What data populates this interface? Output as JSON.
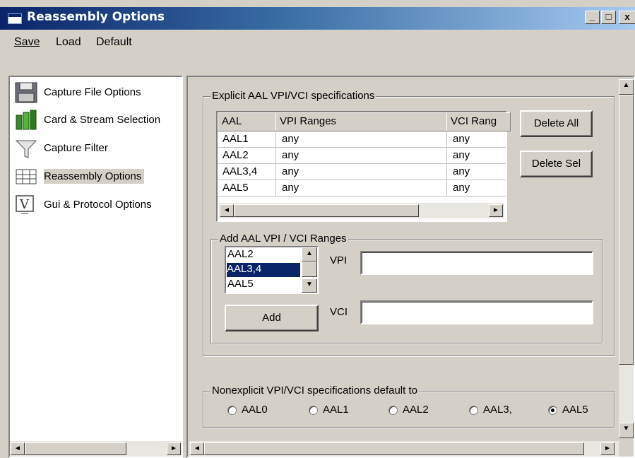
{
  "window": {
    "title": "Reassembly Options",
    "minimize": "_",
    "maximize": "□",
    "close": "x"
  },
  "menu": {
    "save": "Save",
    "load": "Load",
    "default": "Default"
  },
  "nav": [
    {
      "label": "Capture File Options",
      "icon": "floppy-disk-icon"
    },
    {
      "label": "Card & Stream Selection",
      "icon": "card-icon"
    },
    {
      "label": "Capture Filter",
      "icon": "funnel-icon"
    },
    {
      "label": "Reassembly Options",
      "icon": "reassembly-icon",
      "selected": true
    },
    {
      "label": "Gui & Protocol Options",
      "icon": "monitor-icon"
    }
  ],
  "explicit": {
    "title": "Explicit AAL VPI/VCI specifications",
    "columns": [
      "AAL",
      "VPI Ranges",
      "VCI Rang"
    ],
    "rows": [
      [
        "AAL1",
        "any",
        "any"
      ],
      [
        "AAL2",
        "any",
        "any"
      ],
      [
        "AAL3,4",
        "any",
        "any"
      ],
      [
        "AAL5",
        "any",
        "any"
      ]
    ],
    "delete_all": "Delete All",
    "delete_sel": "Delete Sel"
  },
  "add": {
    "title": "Add AAL VPI / VCI Ranges",
    "list": [
      "AAL2",
      "AAL3,4",
      "AAL5"
    ],
    "selected": "AAL3,4",
    "vpi_label": "VPI",
    "vci_label": "VCI",
    "vpi_value": "",
    "vci_value": "",
    "add_button": "Add"
  },
  "nonexplicit": {
    "title": "Nonexplicit VPI/VCI specifications default to",
    "options": [
      "AAL0",
      "AAL1",
      "AAL2",
      "AAL3,",
      "AAL5"
    ],
    "selected": "AAL5"
  },
  "scroll_arrows": {
    "left": "◄",
    "right": "►",
    "up": "▲",
    "down": "▼"
  }
}
